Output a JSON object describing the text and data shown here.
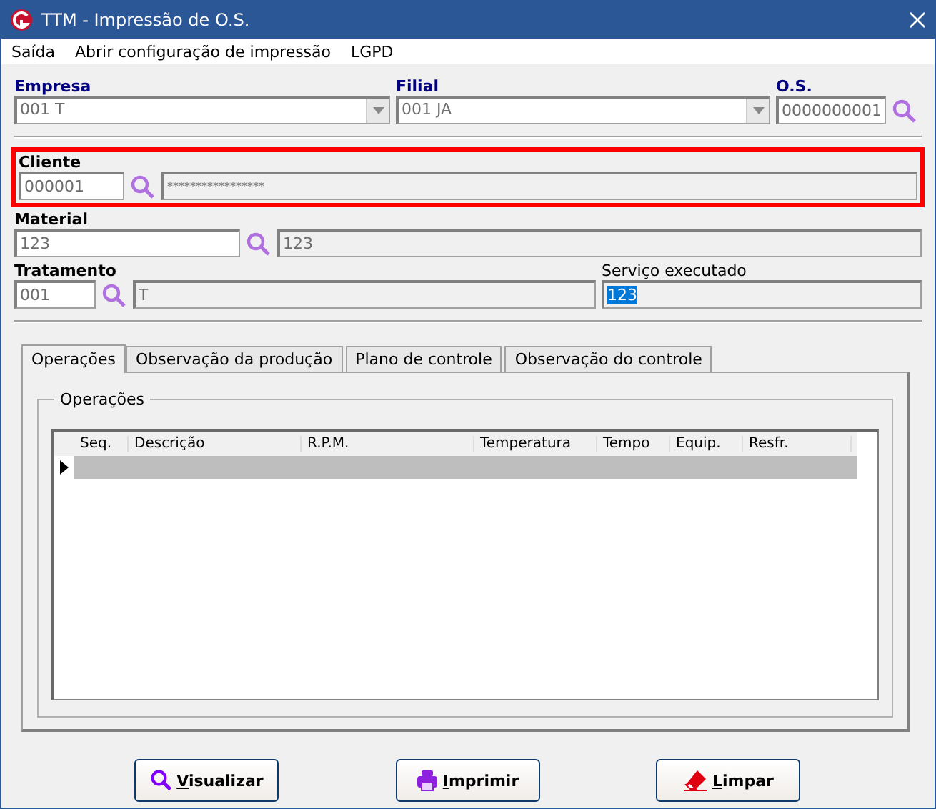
{
  "window": {
    "title": "TTM - Impressão de O.S."
  },
  "menu": [
    "Saída",
    "Abrir configuração de impressão",
    "LGPD"
  ],
  "empresa": {
    "label": "Empresa",
    "value": "001 T"
  },
  "filial": {
    "label": "Filial",
    "value": "001 JA"
  },
  "os": {
    "label": "O.S.",
    "value": "0000000001"
  },
  "cliente": {
    "label": "Cliente",
    "code": "000001",
    "name": "*****************",
    "highlighted": true
  },
  "material": {
    "label": "Material",
    "code": "123",
    "name": "123"
  },
  "tratamento": {
    "label": "Tratamento",
    "code": "001",
    "name": "T"
  },
  "servico": {
    "label": "Serviço executado",
    "value": "123"
  },
  "tabs": [
    {
      "label": "Operações",
      "selected": true
    },
    {
      "label": "Observação da produção",
      "selected": false
    },
    {
      "label": "Plano de controle",
      "selected": false
    },
    {
      "label": "Observação do controle",
      "selected": false
    }
  ],
  "group": {
    "title": "Operações"
  },
  "table": {
    "columns": [
      "Seq.",
      "Descrição",
      "R.P.M.",
      "Temperatura",
      "Tempo",
      "Equip.",
      "Resfr."
    ],
    "rows": [
      {
        "current": true
      }
    ]
  },
  "buttons": [
    {
      "kind": "search",
      "label": "Visualizar"
    },
    {
      "kind": "print",
      "label": "Imprimir"
    },
    {
      "kind": "eraser",
      "label": "Limpar"
    }
  ]
}
